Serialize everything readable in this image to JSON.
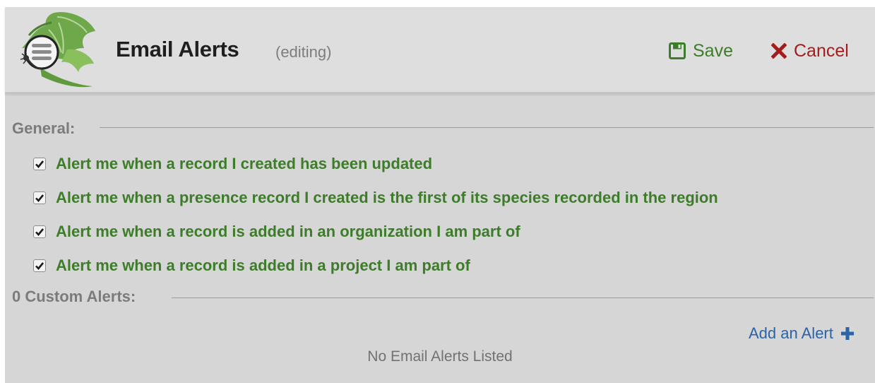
{
  "header": {
    "title": "Email Alerts",
    "subtitle": "(editing)",
    "save_label": "Save",
    "cancel_label": "Cancel"
  },
  "general": {
    "heading": "General:",
    "alerts": [
      {
        "label": "Alert me when a record I created has been updated",
        "checked": true
      },
      {
        "label": "Alert me when a presence record I created is the first of its species recorded in the region",
        "checked": true
      },
      {
        "label": "Alert me when a record is added in an organization I am part of",
        "checked": true
      },
      {
        "label": "Alert me when a record is added in a project I am part of",
        "checked": true
      }
    ]
  },
  "custom": {
    "heading": "0 Custom Alerts:",
    "add_label": "Add an Alert",
    "empty_message": "No Email Alerts Listed"
  },
  "icons": {
    "logo": "leaf-menu-logo-icon",
    "save": "floppy-disk-icon",
    "cancel": "x-icon",
    "add": "plus-icon",
    "checkbox": "checkmark-icon"
  },
  "colors": {
    "green": "#3d7d2a",
    "red": "#a31d1d",
    "blue": "#2a63a6",
    "panel_bg": "#d6d6d6",
    "header_bg": "#dedede"
  }
}
